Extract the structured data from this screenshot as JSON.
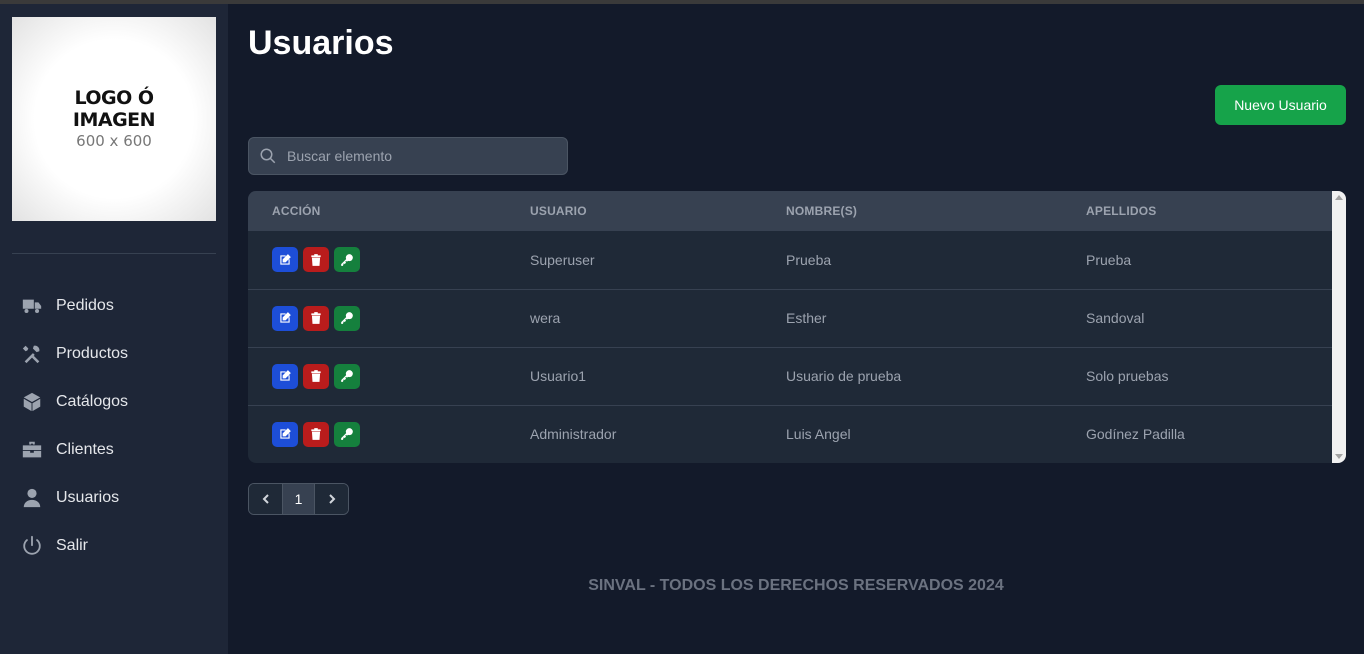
{
  "logo": {
    "line1": "LOGO Ó",
    "line2": "IMAGEN",
    "line3": "600 x 600"
  },
  "sidebar": {
    "items": [
      {
        "label": "Pedidos",
        "icon": "truck-icon"
      },
      {
        "label": "Productos",
        "icon": "tools-icon"
      },
      {
        "label": "Catálogos",
        "icon": "box-icon"
      },
      {
        "label": "Clientes",
        "icon": "briefcase-icon"
      },
      {
        "label": "Usuarios",
        "icon": "user-icon"
      },
      {
        "label": "Salir",
        "icon": "power-icon"
      }
    ]
  },
  "page": {
    "title": "Usuarios",
    "new_button": "Nuevo Usuario"
  },
  "search": {
    "placeholder": "Buscar elemento",
    "value": ""
  },
  "table": {
    "columns": [
      "ACCIÓN",
      "USUARIO",
      "NOMBRE(S)",
      "APELLIDOS"
    ],
    "rows": [
      {
        "usuario": "Superuser",
        "nombre": "Prueba",
        "apellidos": "Prueba"
      },
      {
        "usuario": "wera",
        "nombre": "Esther",
        "apellidos": "Sandoval"
      },
      {
        "usuario": "Usuario1",
        "nombre": "Usuario de prueba",
        "apellidos": "Solo pruebas"
      },
      {
        "usuario": "Administrador",
        "nombre": "Luis Angel",
        "apellidos": "Godínez Padilla"
      }
    ]
  },
  "pagination": {
    "current": "1"
  },
  "footer": {
    "text": "SINVAL - TODOS LOS DERECHOS RESERVADOS 2024"
  },
  "colors": {
    "background": "#131a2a",
    "sidebar": "#1e2637",
    "accent_green": "#16a34a",
    "edit_blue": "#1d4ed8",
    "delete_red": "#b91c1c",
    "key_green": "#15803d"
  }
}
